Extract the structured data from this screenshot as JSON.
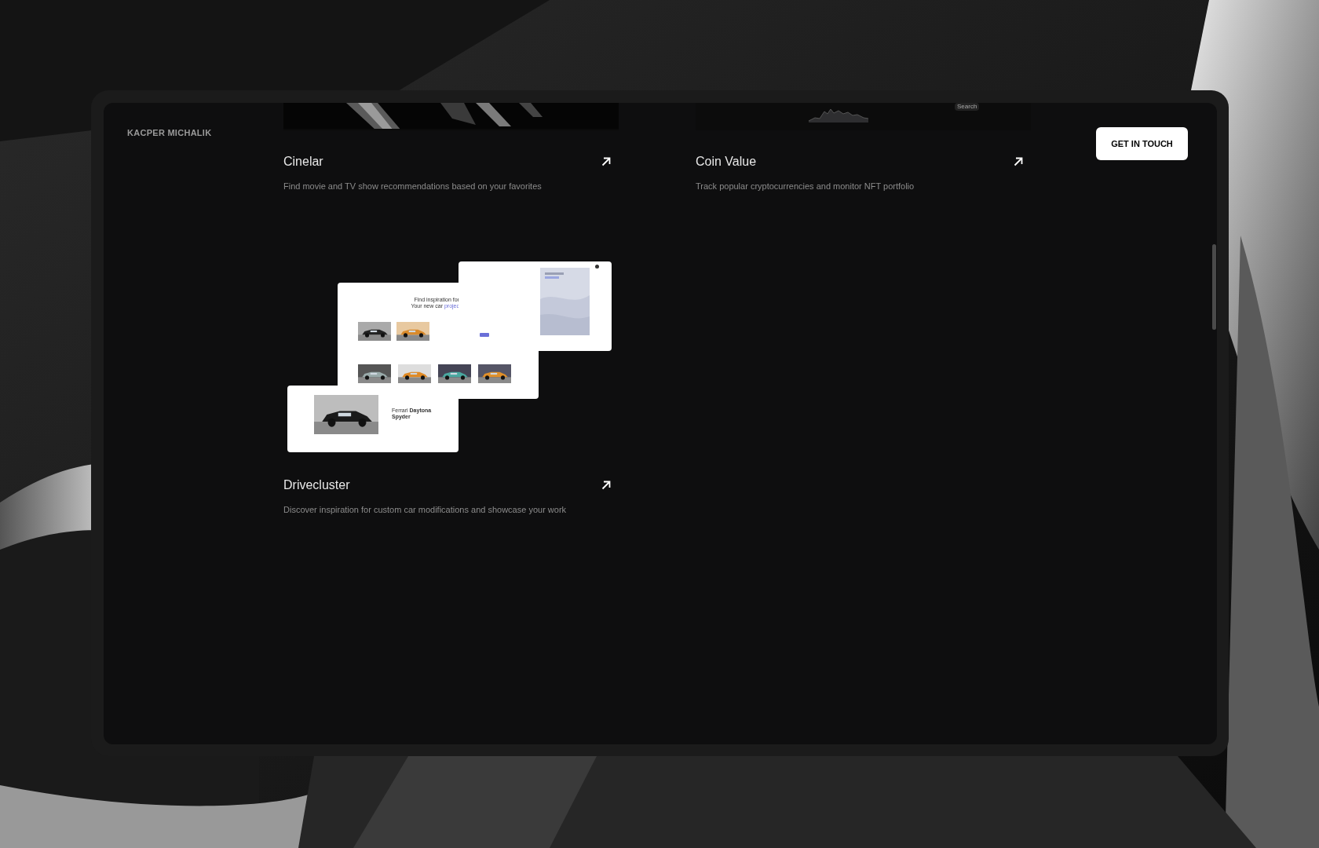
{
  "header": {
    "name": "KACPER MICHALIK",
    "button": "GET IN TOUCH"
  },
  "projects": [
    {
      "title": "Cinelar",
      "description": "Find movie and TV show recommendations based on your favorites",
      "preview": {
        "kind": "streaks"
      }
    },
    {
      "title": "Coin Value",
      "description": "Track popular cryptocurrencies and monitor NFT portfolio",
      "preview": {
        "kind": "sparkline",
        "label": "Search"
      }
    },
    {
      "title": "Drivecluster",
      "description": "Discover inspiration for custom car modifications and showcase your work",
      "preview": {
        "kind": "mockups",
        "headline_1": "Find inspiration for",
        "headline_2": "Your new car ",
        "headline_link": "projec",
        "car_title": "Ferrari **Daytona Spyder**"
      }
    }
  ]
}
